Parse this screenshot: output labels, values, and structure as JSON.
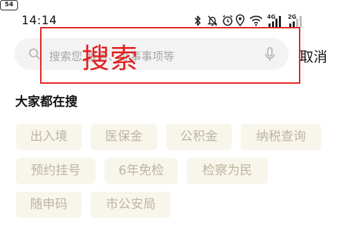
{
  "status_bar": {
    "time": "14:14",
    "net_4g": "4G",
    "net_2g": "2G",
    "battery": "54",
    "icons": [
      "bluetooth-icon",
      "silent-bell-icon",
      "alarm-icon",
      "location-icon",
      "wifi-icon",
      "signal-icon",
      "signal-icon",
      "battery-icon"
    ]
  },
  "search": {
    "placeholder": "搜索您        服务、办事事项等",
    "cancel_label": "取消",
    "search_icon": "search-icon",
    "voice_icon": "microphone-icon"
  },
  "overlay": {
    "label": "搜索",
    "color": "#e51e1e"
  },
  "hot_search": {
    "title": "大家都在搜",
    "tags": [
      "出入境",
      "医保金",
      "公积金",
      "纳税查询",
      "预约挂号",
      "6年免检",
      "检察为民",
      "随申码",
      "市公安局"
    ]
  },
  "colors": {
    "tag_bg": "#f8f5eb",
    "tag_text": "#bdb5a0",
    "search_bg": "#f3f3f3"
  }
}
